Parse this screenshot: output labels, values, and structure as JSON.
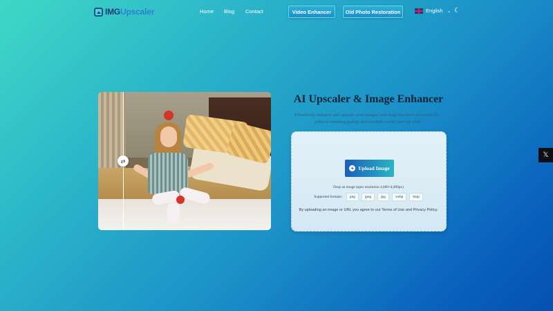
{
  "brand": {
    "logo_img": "IMG",
    "logo_rest": "Upscaler"
  },
  "nav": {
    "links": [
      "Home",
      "Blog",
      "Contact"
    ],
    "buttons": [
      "Video Enhancer",
      "Old Photo Restoration"
    ],
    "language": "English",
    "language_icon": "uk-flag-icon",
    "theme_icon": "moon-icon"
  },
  "hero": {
    "title": "AI Upscaler & Image Enhancer",
    "subtitle_line1": "Effortlessly enhance and upscale your images with ImgUpscaler's powerful AI—",
    "subtitle_line2": "achieve stunning quality and resolution with just one click."
  },
  "compare": {
    "handle_icon": "swap-arrows-icon",
    "handle_glyph": "⇄"
  },
  "upload": {
    "button_label": "Upload Image",
    "drop_text": "Drop an image (upto resolution 4,000×4,000px)",
    "formats_label": "Supported formats:",
    "formats": [
      "png",
      "jpeg",
      "jpg",
      "webp",
      "bmp"
    ],
    "terms": "By uploading an image or URL you agree to our Terms of Use and Privacy Policy."
  },
  "share": {
    "x_icon": "x-twitter-icon",
    "x_glyph": "𝕏"
  },
  "colors": {
    "accent": "#1a5fb7",
    "accent2": "#2bb5c4",
    "title": "#0f2438"
  }
}
